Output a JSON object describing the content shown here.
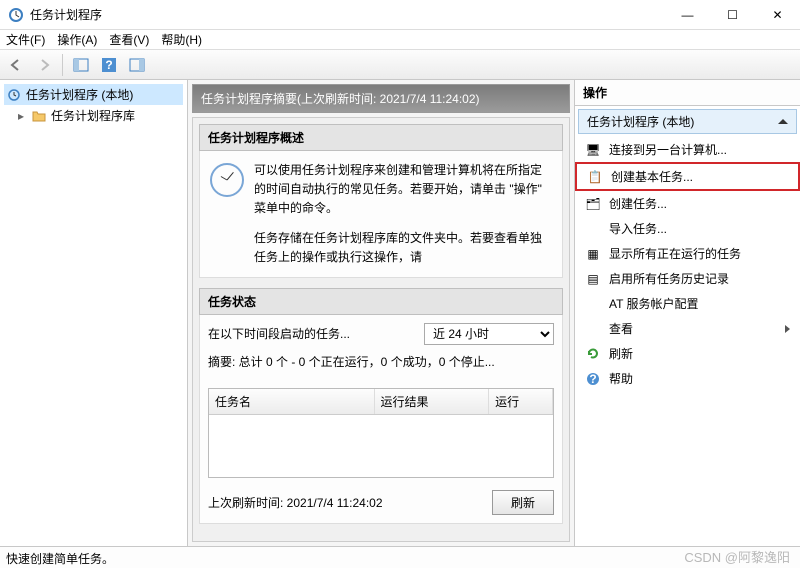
{
  "titlebar": {
    "title": "任务计划程序"
  },
  "menu": {
    "file": "文件(F)",
    "action": "操作(A)",
    "view": "查看(V)",
    "help": "帮助(H)"
  },
  "tree": {
    "root": "任务计划程序 (本地)",
    "library": "任务计划程序库"
  },
  "center": {
    "header": "任务计划程序摘要(上次刷新时间: 2021/7/4 11:24:02)",
    "overview_title": "任务计划程序概述",
    "overview_text_1": "可以使用任务计划程序来创建和管理计算机将在所指定的时间自动执行的常见任务。若要开始，请单击 \"操作\" 菜单中的命令。",
    "overview_text_2": "任务存储在任务计划程序库的文件夹中。若要查看单独任务上的操作或执行这操作，请",
    "status_title": "任务状态",
    "status_period_label": "在以下时间段启动的任务...",
    "status_period_value": "近 24 小时",
    "status_summary": "摘要: 总计 0 个 - 0 个正在运行，0 个成功，0 个停止...",
    "col_name": "任务名",
    "col_result": "运行结果",
    "col_run": "运行",
    "last_refresh": "上次刷新时间: 2021/7/4 11:24:02",
    "refresh_btn": "刷新"
  },
  "right": {
    "header": "操作",
    "subheader": "任务计划程序 (本地)",
    "items": [
      "连接到另一台计算机...",
      "创建基本任务...",
      "创建任务...",
      "导入任务...",
      "显示所有正在运行的任务",
      "启用所有任务历史记录",
      "AT 服务帐户配置",
      "查看",
      "刷新",
      "帮助"
    ]
  },
  "statusbar": {
    "text": "快速创建简单任务。"
  },
  "watermark": "CSDN @阿黎逸阳"
}
